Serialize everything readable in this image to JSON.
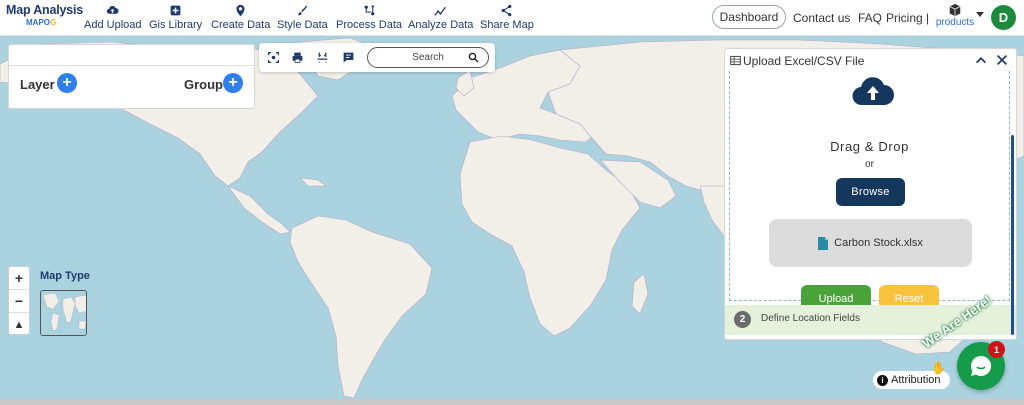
{
  "brand": {
    "title": "Map Analysis",
    "sub_prefix": "MAPO",
    "sub_suffix": "G"
  },
  "nav": [
    {
      "label": "Add Upload",
      "icon": "cloud-upload-icon"
    },
    {
      "label": "Gis Library",
      "icon": "library-plus-icon"
    },
    {
      "label": "Create Data",
      "icon": "map-pin-icon"
    },
    {
      "label": "Style Data",
      "icon": "paint-brush-icon"
    },
    {
      "label": "Process Data",
      "icon": "process-icon"
    },
    {
      "label": "Analyze Data",
      "icon": "analyze-icon"
    },
    {
      "label": "Share Map",
      "icon": "share-icon"
    }
  ],
  "header": {
    "dashboard": "Dashboard",
    "contact": "Contact us",
    "faq": "FAQ",
    "pricing": "Pricing |",
    "products": "products",
    "avatar_initial": "D"
  },
  "layer_panel": {
    "layer_label": "Layer",
    "group_label": "Group"
  },
  "toolbar": {
    "search_placeholder": "Search"
  },
  "map_controls": {
    "zoom_in": "+",
    "zoom_out": "−",
    "reset_north": "▲",
    "map_type_label": "Map Type"
  },
  "upload_panel": {
    "title": "Upload Excel/CSV File",
    "drag_text": "Drag & Drop",
    "or_text": "or",
    "browse_label": "Browse",
    "file_name": "Carbon Stock.xlsx",
    "upload_label": "Upload",
    "reset_label": "Reset",
    "step_number": "2",
    "step_label": "Define Location Fields"
  },
  "attribution": "Attribution",
  "chat": {
    "badge_count": "1",
    "tagline": "We Are Here!"
  },
  "colors": {
    "ocean": "#aad3df",
    "land": "#f2efe9",
    "border": "#b9a8c6",
    "brand_navy": "#1e3a6e",
    "accent_blue": "#2f80ed",
    "browse_navy": "#15375e",
    "upload_green": "#4ba23a",
    "reset_yellow": "#f8c23c",
    "chat_green": "#149c4a"
  }
}
